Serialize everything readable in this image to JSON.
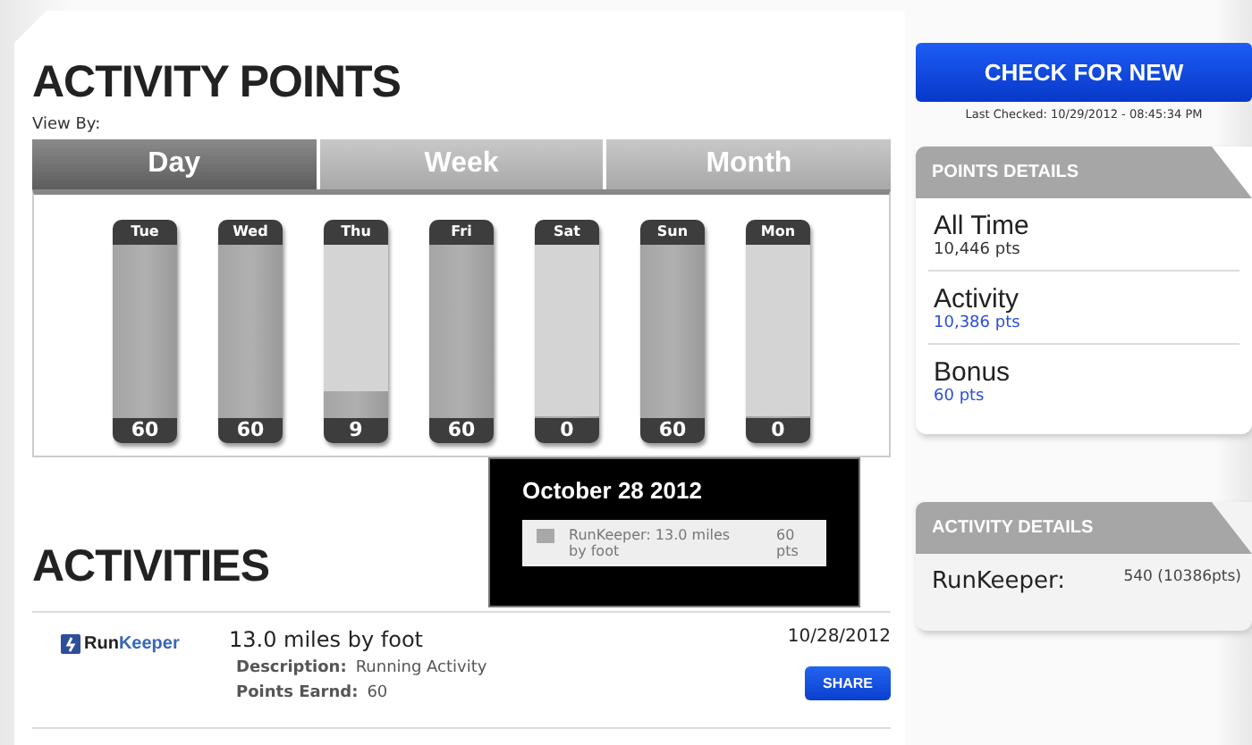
{
  "activity_points": {
    "title": "ACTIVITY POINTS",
    "view_by_label": "View By:",
    "tabs": [
      {
        "label": "Day",
        "selected": true
      },
      {
        "label": "Week",
        "selected": false
      },
      {
        "label": "Month",
        "selected": false
      }
    ],
    "days": [
      {
        "day": "Tue",
        "value": "60",
        "level": 1
      },
      {
        "day": "Wed",
        "value": "60",
        "level": 1
      },
      {
        "day": "Thu",
        "value": "9",
        "level": 0.15
      },
      {
        "day": "Fri",
        "value": "60",
        "level": 1
      },
      {
        "day": "Sat",
        "value": "0",
        "level": 0
      },
      {
        "day": "Sun",
        "value": "60",
        "level": 1
      },
      {
        "day": "Mon",
        "value": "0",
        "level": 0
      }
    ],
    "tooltip": {
      "date": "October 28 2012",
      "entries": [
        {
          "color": "#a8a8a8",
          "label": "RunKeeper: 13.0 miles by foot",
          "points": "60 pts"
        }
      ]
    }
  },
  "activities": {
    "title": "ACTIVITIES",
    "items": [
      {
        "logo": [
          "Run",
          "Keeper"
        ],
        "title": "13.0 miles by foot",
        "date": "10/28/2012",
        "description_label": "Description:",
        "description": "Running Activity",
        "points_label": "Points Earnd:",
        "points": "60",
        "share": "SHARE"
      }
    ]
  },
  "check_button": "CHECK FOR NEW",
  "last_checked": "Last Checked: 10/29/2012 - 08:45:34 PM",
  "points_details": {
    "title": "POINTS DETAILS",
    "items": [
      {
        "label": "All Time",
        "value": "10,446 pts",
        "linked": false
      },
      {
        "label": "Activity",
        "value": "10,386 pts",
        "linked": true
      },
      {
        "label": "Bonus",
        "value": "60 pts",
        "linked": true
      }
    ]
  },
  "activity_details": {
    "title": "ACTIVITY DETAILS",
    "items": [
      {
        "label": "RunKeeper:",
        "value": "540 (10386pts)"
      }
    ]
  }
}
